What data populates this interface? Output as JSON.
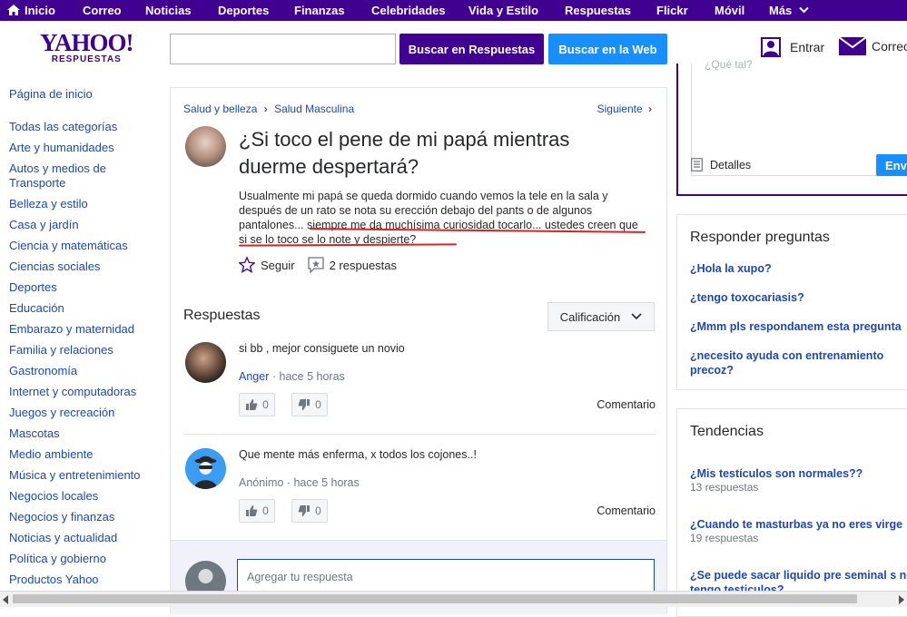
{
  "topnav": {
    "items": [
      "Inicio",
      "Correo",
      "Noticias",
      "Deportes",
      "Finanzas",
      "Celebridades",
      "Vida y Estilo",
      "Respuestas",
      "Flickr",
      "Móvil",
      "Más"
    ]
  },
  "header": {
    "logo_main": "YAHOO!",
    "logo_sub": "RESPUESTAS",
    "search_value": "",
    "search_answers_label": "Buscar en Respuestas",
    "search_web_label": "Buscar en la Web",
    "signin_label": "Entrar",
    "mail_label": "Correo"
  },
  "sidebar": {
    "items": [
      "Página de inicio",
      "Todas las categorías",
      "Arte y humanidades",
      "Autos y medios de Transporte",
      "Belleza y estilo",
      "Casa y jardín",
      "Ciencia y matemáticas",
      "Ciencias sociales",
      "Deportes",
      "Educación",
      "Embarazo y maternidad",
      "Familia y relaciones",
      "Gastronomía",
      "Internet y computadoras",
      "Juegos y recreación",
      "Mascotas",
      "Medio ambiente",
      "Música y entretenimiento",
      "Negocios locales",
      "Negocios y finanzas",
      "Noticias y actualidad",
      "Política y gobierno",
      "Productos Yahoo"
    ]
  },
  "question": {
    "breadcrumb_1": "Salud y belleza",
    "breadcrumb_2": "Salud Masculina",
    "next_label": "Siguiente",
    "title": "¿Si toco el pene de mi papá mientras duerme despertará?",
    "body": "Usualmente mi papá se queda dormido cuando vemos la tele en la sala y después de un rato se nota su erección debajo del pants o de algunos pantalones... siempre me da muchísima curiosidad tocarlo... ustedes creen que si se lo toco se lo note y despierte?",
    "follow_label": "Seguir",
    "answers_count_label": "2 respuestas"
  },
  "answers_section": {
    "title": "Respuestas",
    "sort_label": "Calificación",
    "items": [
      {
        "text": "si bb , mejor consiguete un novio",
        "author": "Anger",
        "time": "hace 5 horas",
        "up": "0",
        "down": "0",
        "comment": "Comentario"
      },
      {
        "text": "Que mente más enferma, x todos los cojones..!",
        "author": "Anónimo",
        "time": "hace 5 horas",
        "up": "0",
        "down": "0",
        "comment": "Comentario"
      }
    ],
    "add_placeholder": "Agregar tu respuesta",
    "meta_separator": "·"
  },
  "ask_box": {
    "placeholder_fragment": "¿Qué tal?",
    "details_label": "Detalles",
    "send_label": "Envi"
  },
  "answer_questions": {
    "title": "Responder preguntas",
    "items": [
      "¿Hola la xupo?",
      "¿tengo toxocariasis?",
      "¿Mmm pls respondanem esta pregunta",
      "¿necesito ayuda con entrenamiento precoz?"
    ]
  },
  "trending": {
    "title": "Tendencias",
    "items": [
      {
        "q": "¿Mis testículos son normales??",
        "count": "13 respuestas"
      },
      {
        "q": "¿Cuando te masturbas ya no eres virge",
        "count": "19 respuestas"
      },
      {
        "q": "¿Se puede sacar liquido pre seminal s no tengo testiculos?",
        "count": ""
      }
    ]
  },
  "colors": {
    "brand_purple": "#400090",
    "link_blue": "#1b48b5",
    "button_blue": "#188fff",
    "underline_red": "#e0201b"
  }
}
